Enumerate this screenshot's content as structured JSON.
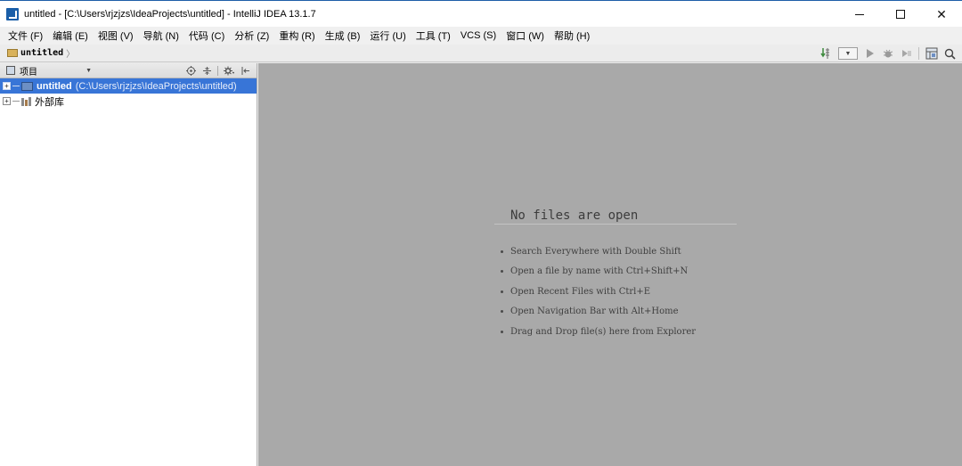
{
  "window": {
    "title": "untitled - [C:\\Users\\rjzjzs\\IdeaProjects\\untitled] - IntelliJ IDEA 13.1.7",
    "controls": {
      "minimize": "minimize",
      "maximize": "maximize",
      "close": "✕"
    }
  },
  "menu": [
    {
      "label": "文件 (F)"
    },
    {
      "label": "编辑 (E)"
    },
    {
      "label": "视图 (V)"
    },
    {
      "label": "导航 (N)"
    },
    {
      "label": "代码 (C)"
    },
    {
      "label": "分析 (Z)"
    },
    {
      "label": "重构 (R)"
    },
    {
      "label": "生成 (B)"
    },
    {
      "label": "运行 (U)"
    },
    {
      "label": "工具 (T)"
    },
    {
      "label": "VCS (S)"
    },
    {
      "label": "窗口 (W)"
    },
    {
      "label": "帮助 (H)"
    }
  ],
  "toolbar": {
    "breadcrumb": "untitled",
    "icons": [
      "make-project-icon",
      "run-config-dropdown",
      "run-icon",
      "debug-icon",
      "coverage-icon",
      "project-structure-icon",
      "search-everywhere-icon"
    ]
  },
  "project_panel": {
    "view_label": "项目",
    "tree": [
      {
        "name": "untitled",
        "path": "(C:\\Users\\rjzjzs\\IdeaProjects\\untitled)",
        "selected": true,
        "icon": "module-icon"
      },
      {
        "name": "外部库",
        "icon": "library-icon"
      }
    ]
  },
  "editor": {
    "empty_title": "No files are open",
    "hints": [
      "Search Everywhere with Double Shift",
      "Open a file by name with Ctrl+Shift+N",
      "Open Recent Files with Ctrl+E",
      "Open Navigation Bar with Alt+Home",
      "Drag and Drop file(s) here from Explorer"
    ]
  },
  "colors": {
    "selection": "#3875d7",
    "editor_background": "#a9a9a9",
    "panel_background": "#ffffff"
  }
}
